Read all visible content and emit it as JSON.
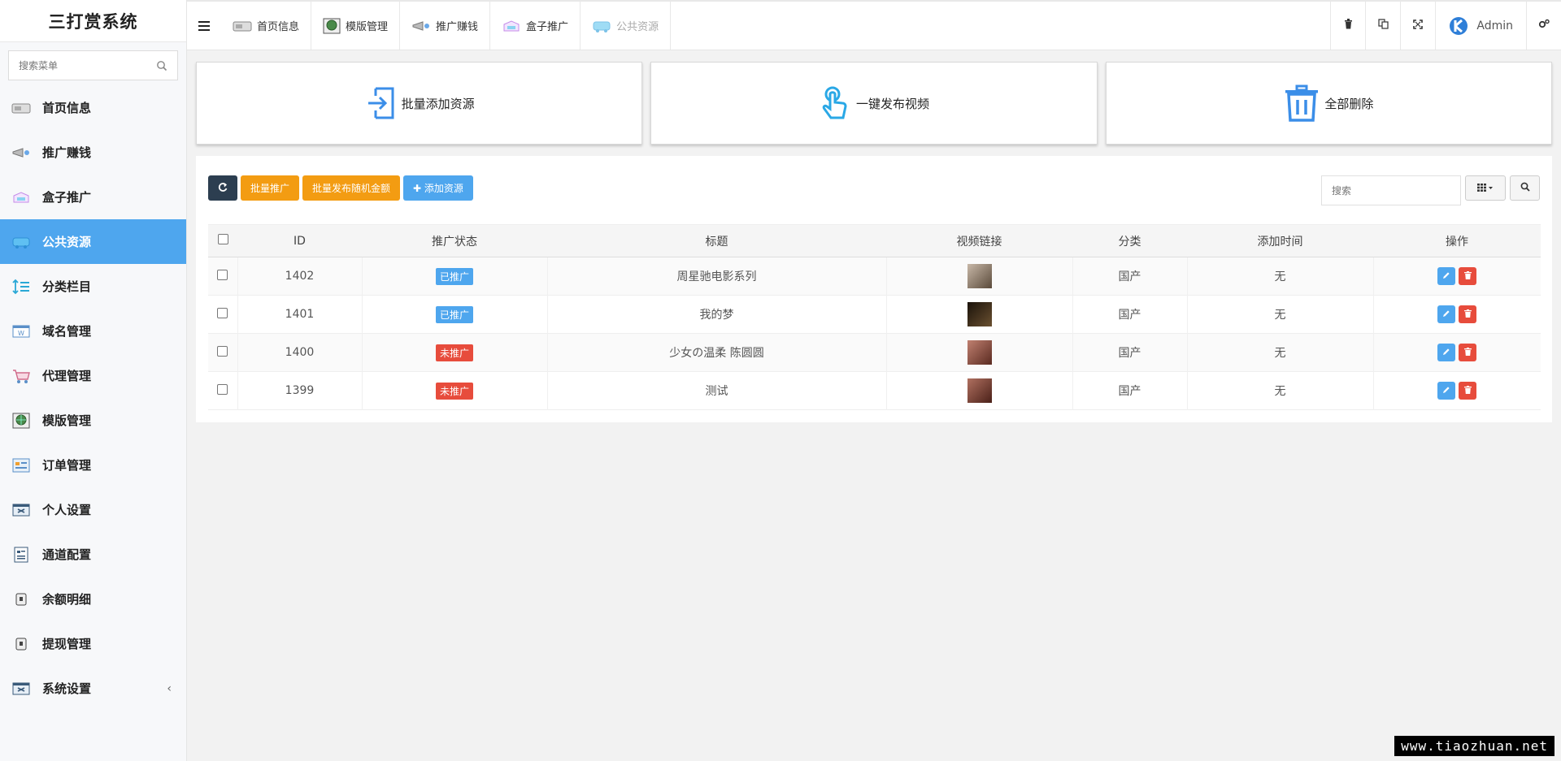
{
  "app": {
    "title": "三打赏系统"
  },
  "sidebar": {
    "search_placeholder": "搜索菜单",
    "items": [
      {
        "label": "首页信息",
        "icon": "home-card-icon"
      },
      {
        "label": "推广赚钱",
        "icon": "megaphone-icon"
      },
      {
        "label": "盒子推广",
        "icon": "box-icon"
      },
      {
        "label": "公共资源",
        "icon": "cloud-resource-icon",
        "active": true
      },
      {
        "label": "分类栏目",
        "icon": "sort-arrows-icon"
      },
      {
        "label": "域名管理",
        "icon": "domain-icon"
      },
      {
        "label": "代理管理",
        "icon": "cart-icon"
      },
      {
        "label": "模版管理",
        "icon": "globe-icon"
      },
      {
        "label": "订单管理",
        "icon": "order-icon"
      },
      {
        "label": "个人设置",
        "icon": "settings-card-icon"
      },
      {
        "label": "通道配置",
        "icon": "channel-icon"
      },
      {
        "label": "余额明细",
        "icon": "balance-icon"
      },
      {
        "label": "提现管理",
        "icon": "withdraw-icon"
      },
      {
        "label": "系统设置",
        "icon": "system-icon"
      }
    ],
    "collapse_caret": "‹"
  },
  "topbar": {
    "tabs": [
      {
        "label": "首页信息"
      },
      {
        "label": "模版管理"
      },
      {
        "label": "推广赚钱"
      },
      {
        "label": "盒子推广"
      },
      {
        "label": "公共资源"
      }
    ],
    "user": "Admin"
  },
  "cards": [
    {
      "label": "批量添加资源",
      "icon": "import-icon"
    },
    {
      "label": "一键发布视频",
      "icon": "tap-hand-icon"
    },
    {
      "label": "全部删除",
      "icon": "trash-icon"
    }
  ],
  "toolbar": {
    "batch_promote": "批量推广",
    "batch_random": "批量发布随机金额",
    "add_resource": "✚ 添加资源",
    "search_placeholder": "搜索"
  },
  "table": {
    "headers": [
      "ID",
      "推广状态",
      "标题",
      "视频链接",
      "分类",
      "添加时间",
      "操作"
    ],
    "rows": [
      {
        "id": "1402",
        "status": "已推广",
        "promoted": true,
        "title": "周星驰电影系列",
        "category": "国产",
        "time": "无",
        "thumb": "#9a8a7a"
      },
      {
        "id": "1401",
        "status": "已推广",
        "promoted": true,
        "title": "我的梦",
        "category": "国产",
        "time": "无",
        "thumb": "#3a2a1a"
      },
      {
        "id": "1400",
        "status": "未推广",
        "promoted": false,
        "title": "少女の温柔 陈圆圆",
        "category": "国产",
        "time": "无",
        "thumb": "#8a4a3a"
      },
      {
        "id": "1399",
        "status": "未推广",
        "promoted": false,
        "title": "测试",
        "category": "国产",
        "time": "无",
        "thumb": "#7a4030"
      }
    ]
  },
  "watermark": "www.tiaozhuan.net",
  "colors": {
    "accent": "#4ea6ee",
    "orange": "#f39c12",
    "red": "#e74c3c",
    "dark": "#2c3e50"
  }
}
